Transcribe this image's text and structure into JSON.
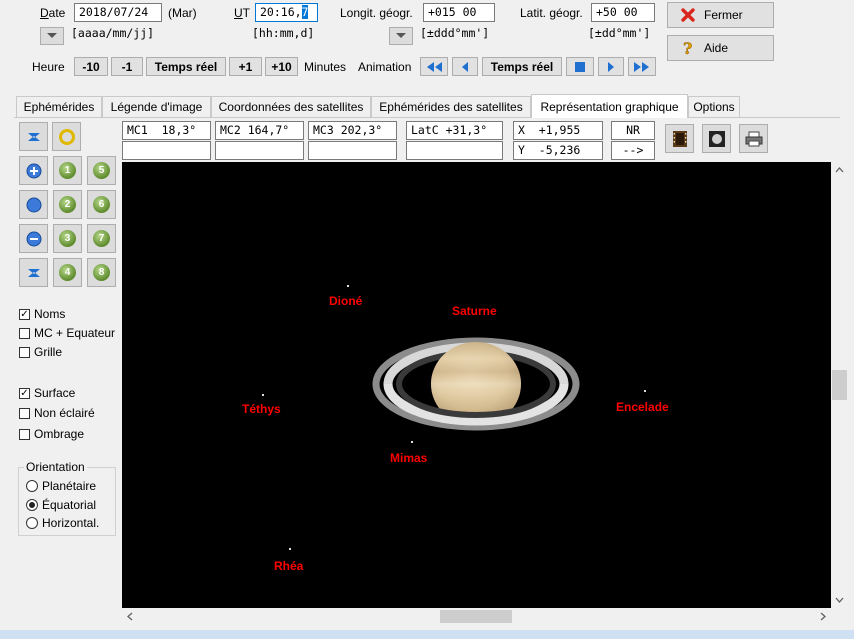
{
  "toolbar": {
    "date_label": "Date",
    "date_value": "2018/07/24",
    "date_day": "(Mar)",
    "date_format": "[aaaa/mm/jj]",
    "ut_label": "UT",
    "ut_value": "20:16,",
    "ut_cursor": "7",
    "ut_format": "[hh:mm,d]",
    "longit_label": "Longit. géogr.",
    "longit_value": "+015 00",
    "longit_format": "[±ddd°mm']",
    "latit_label": "Latit. géogr.",
    "latit_value": "+50 00",
    "latit_format": "[±dd°mm']",
    "close_label": "Fermer",
    "help_label": "Aide"
  },
  "time_controls": {
    "heure_label": "Heure",
    "minus10": "-10",
    "minus1": "-1",
    "temps_reel": "Temps réel",
    "plus1": "+1",
    "plus10": "+10",
    "minutes_label": "Minutes",
    "animation_label": "Animation",
    "anim_temps_reel": "Temps réel"
  },
  "tabs": [
    {
      "label": "Ephémérides"
    },
    {
      "label": "Légende d'image"
    },
    {
      "label": "Coordonnées des satellites"
    },
    {
      "label": "Ephémérides des satellites"
    },
    {
      "label": "Représentation graphique"
    },
    {
      "label": "Options"
    }
  ],
  "readouts": {
    "mc1": "MC1  18,3°",
    "mc2": "MC2 164,7°",
    "mc3": "MC3 202,3°",
    "latc": "LatC +31,3°",
    "x": "X  +1,955",
    "y": "Y  -5,236",
    "nr": "NR",
    "arrow": "-->"
  },
  "left_panel": {
    "num_buttons": [
      "1",
      "2",
      "3",
      "4",
      "5",
      "6",
      "7",
      "8"
    ],
    "noms": "Noms",
    "mc_equateur": "MC + Equateur",
    "grille": "Grille",
    "surface": "Surface",
    "non_eclaire": "Non éclairé",
    "ombrage": "Ombrage",
    "orientation_title": "Orientation",
    "planetaire": "Planétaire",
    "equatorial": "Équatorial",
    "horizontal": "Horizontal."
  },
  "view": {
    "labels": {
      "dione": "Dioné",
      "saturne": "Saturne",
      "tethys": "Téthys",
      "encelade": "Encelade",
      "mimas": "Mimas",
      "rhea": "Rhéa"
    }
  },
  "colors": {
    "label_red": "#ff0000",
    "background": "#000000",
    "accent_blue": "#0078d7"
  }
}
